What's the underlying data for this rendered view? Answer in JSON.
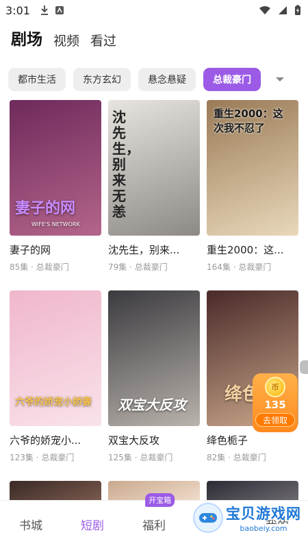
{
  "status_bar": {
    "time": "3:01"
  },
  "top_tabs": [
    {
      "label": "剧场"
    },
    {
      "label": "视频"
    },
    {
      "label": "看过"
    }
  ],
  "categories": [
    {
      "label": "都市生活"
    },
    {
      "label": "东方玄幻"
    },
    {
      "label": "悬念悬疑"
    },
    {
      "label": "总裁豪门"
    }
  ],
  "dramas": [
    {
      "title": "妻子的网",
      "meta": "85集 · 总裁豪门",
      "poster_text": "妻子的网",
      "poster_sub": "WIFE'S NETWORK",
      "colors": [
        "#6e2a5c",
        "#b4658a"
      ]
    },
    {
      "title": "沈先生，别来...",
      "meta": "79集 · 总裁豪门",
      "poster_text": "沈先生，别来无恙",
      "poster_sub": "",
      "colors": [
        "#e8e4df",
        "#8d8a86"
      ]
    },
    {
      "title": "重生2000：这...",
      "meta": "164集 · 总裁豪门",
      "poster_text": "重生2000：这次我不忍了",
      "poster_sub": "",
      "colors": [
        "#9a7b57",
        "#e9d8bb"
      ]
    },
    {
      "title": "六爷的娇宠小...",
      "meta": "123集 · 总裁豪门",
      "poster_text": "六爷的娇宠小娇妻",
      "poster_sub": "",
      "colors": [
        "#f0b6cc",
        "#f9e2ea"
      ]
    },
    {
      "title": "双宝大反攻",
      "meta": "125集 · 总裁豪门",
      "poster_text": "双宝大反攻",
      "poster_sub": "",
      "colors": [
        "#3b3a3f",
        "#b9b3ac"
      ]
    },
    {
      "title": "绛色栀子",
      "meta": "82集 · 总裁豪门",
      "poster_text": "绛色栀子",
      "poster_sub": "",
      "colors": [
        "#4a2a2a",
        "#c9a68a"
      ]
    }
  ],
  "partial_posters": [
    {
      "colors": [
        "#3a2a26",
        "#7a5a4e"
      ]
    },
    {
      "colors": [
        "#c9a98e",
        "#f0dccb"
      ]
    },
    {
      "colors": [
        "#2b2b33",
        "#6e6a72"
      ]
    }
  ],
  "reward": {
    "count": "135",
    "button": "去领取"
  },
  "bottom_nav": [
    {
      "label": "书城"
    },
    {
      "label": "短剧"
    },
    {
      "label": "福利",
      "badge": "开宝箱"
    },
    {
      "label": ""
    },
    {
      "label": "我的"
    }
  ],
  "watermark": {
    "main": "宝贝游戏网",
    "sub": "baobeiy.com"
  },
  "accent": "#9b5be6"
}
